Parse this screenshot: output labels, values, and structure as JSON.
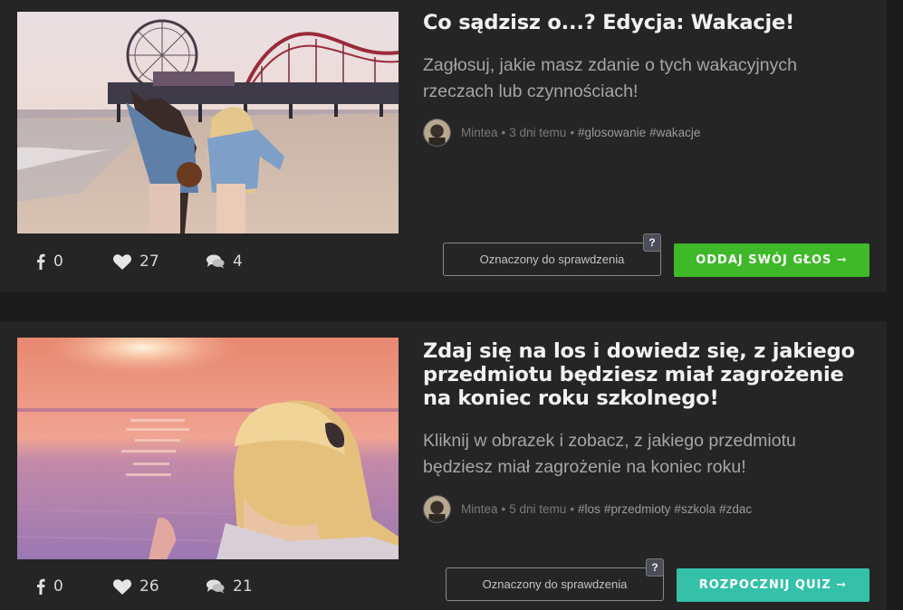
{
  "posts": [
    {
      "title": "Co sądzisz o...? Edycja: Wakacje!",
      "description": "Zagłosuj, jakie masz zdanie o tych wakacyjnych rzeczach lub czynnościach!",
      "author": "Mintea",
      "time": "3 dni temu",
      "tags": [
        "#glosowanie",
        "#wakacje"
      ],
      "shares": "0",
      "likes": "27",
      "comments": "4",
      "review_label": "Oznaczony do sprawdzenia",
      "help_label": "?",
      "cta_label": "ODDAJ SWÓJ GŁOS ➞",
      "cta_color": "#3fb82a",
      "image": "two girls walking on beach near pier with ferris wheel"
    },
    {
      "title": "Zdaj się na los i dowiedz się, z jakiego przedmiotu będziesz miał zagrożenie na koniec roku szkolnego!",
      "description": "Kliknij w obrazek i zobacz, z jakiego przedmiotu będziesz miał zagrożenie na koniec roku!",
      "author": "Mintea",
      "time": "5 dni temu",
      "tags": [
        "#los",
        "#przedmioty",
        "#szkola",
        "#zdac"
      ],
      "shares": "0",
      "likes": "26",
      "comments": "21",
      "review_label": "Oznaczony do sprawdzenia",
      "help_label": "?",
      "cta_label": "ROZPOCZNIJ QUIZ ➞",
      "cta_color": "#35c0a9",
      "image": "blonde girl looking at pink sunset over the sea"
    }
  ],
  "separator": "•",
  "icons": {
    "share": "facebook-icon",
    "like": "heart-icon",
    "comments": "comments-icon",
    "help": "question-icon"
  }
}
